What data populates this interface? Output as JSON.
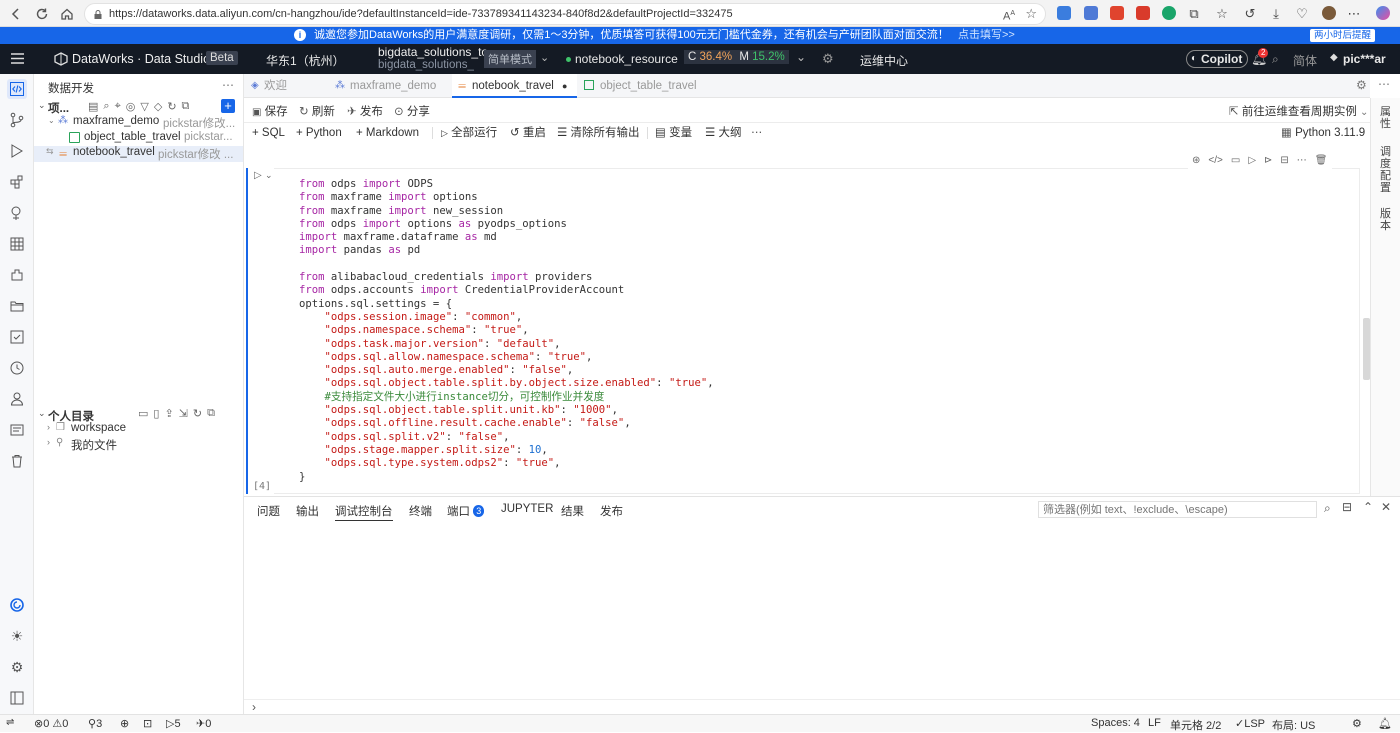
{
  "browser": {
    "url": "https://dataworks.data.aliyun.com/cn-hangzhou/ide?defaultInstanceId=ide-733789341143234-840f8d2&defaultProjectId=332475"
  },
  "notice": {
    "text": "诚邀您参加DataWorks的用户满意度调研，仅需1～3分钟，优质填答可获得100元无门槛代金券，还有机会与产研团队面对面交流！",
    "link": "点击填写>>",
    "remind": "两小时后提醒"
  },
  "header": {
    "app_title": "DataWorks · Data Studio",
    "beta": "Beta",
    "region": "华东1（杭州）",
    "project_line1": "bigdata_solutions_to",
    "project_line2": "bigdata_solutions_",
    "mode": "简单模式",
    "resource": "notebook_resource",
    "cpu_label": "C",
    "cpu": "36.4%",
    "mem_label": "M",
    "mem": "15.2%",
    "ops_center": "运维中心",
    "copilot": "Copilot",
    "notif_count": "2",
    "lang": "简体",
    "user": "pic***ar"
  },
  "sidebar": {
    "title": "数据开发",
    "project_label": "项...",
    "tree": [
      {
        "name": "maxframe_demo",
        "meta": "pickstar修改..."
      },
      {
        "name": "object_table_travel",
        "meta": "pickstar..."
      },
      {
        "name": "notebook_travel",
        "meta": "pickstar修改 ..."
      }
    ],
    "personal_title": "个人目录",
    "personal": [
      {
        "name": "workspace"
      },
      {
        "name": "我的文件"
      }
    ]
  },
  "tabs": [
    {
      "label": "欢迎"
    },
    {
      "label": "maxframe_demo"
    },
    {
      "label": "notebook_travel"
    },
    {
      "label": "object_table_travel"
    }
  ],
  "toolbar1": {
    "save": "保存",
    "refresh": "刷新",
    "publish": "发布",
    "share": "分享",
    "goto_ops": "前往运维查看周期实例"
  },
  "toolbar2": {
    "sql": "SQL",
    "python": "Python",
    "markdown": "Markdown",
    "run_all": "全部运行",
    "restart": "重启",
    "clear": "清除所有输出",
    "variables": "变量",
    "outline": "大纲",
    "kernel": "Python 3.11.9"
  },
  "cell": {
    "exec_count": "[4]"
  },
  "panel": {
    "tabs": [
      "问题",
      "输出",
      "调试控制台",
      "终端",
      "端口",
      "JUPYTER",
      "结果",
      "发布"
    ],
    "ports_count": "3",
    "filter_placeholder": "筛选器(例如 text、!exclude、\\escape)"
  },
  "rightbar": [
    "属性",
    "调度配置",
    "版本"
  ],
  "status": {
    "errors": "0",
    "warnings": "0",
    "ports": "3",
    "items": "5",
    "branch": "0",
    "spaces": "Spaces: 4",
    "eol": "LF",
    "cell": "单元格 2/2",
    "lsp": "LSP",
    "layout": "布局: US"
  },
  "colors": {
    "accent": "#1766e8",
    "header_bg": "#141a24",
    "keyword": "#a626a4",
    "string": "#c41a16",
    "comment": "#3a8a3a"
  }
}
